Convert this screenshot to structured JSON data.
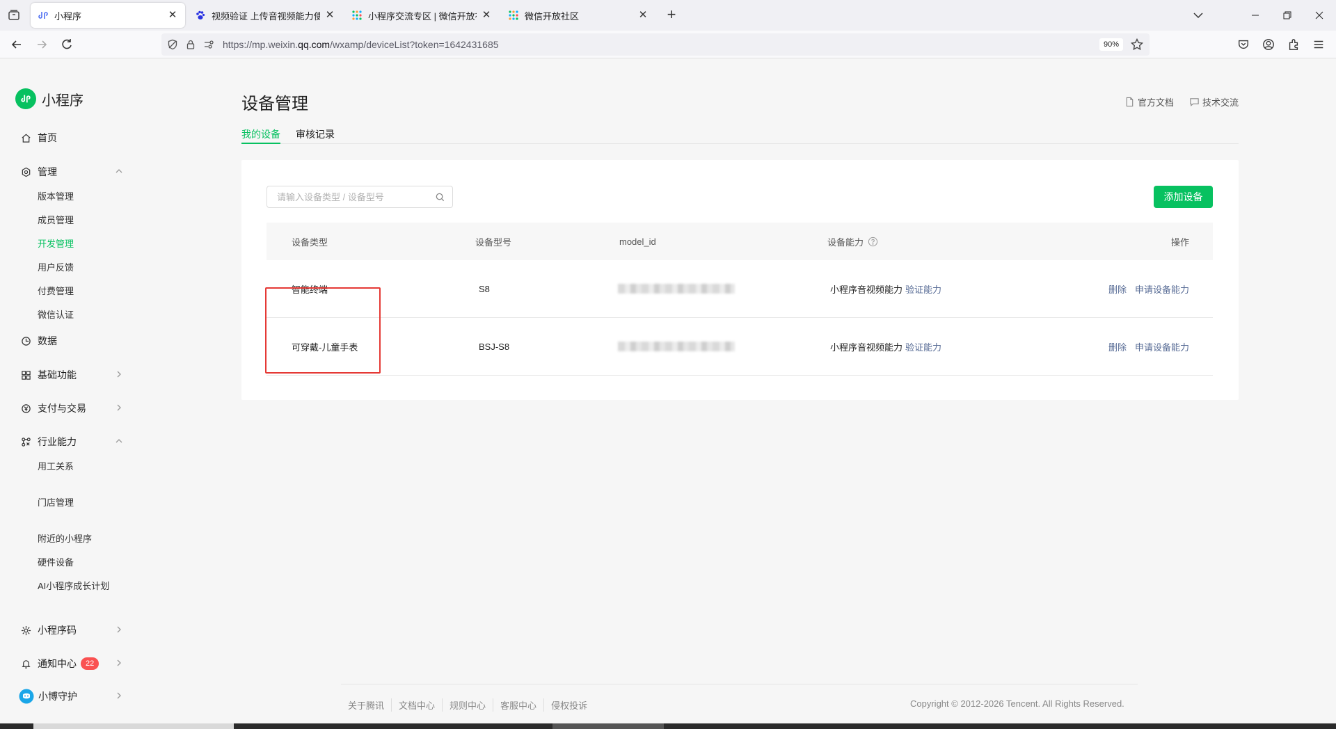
{
  "browser": {
    "tabs": [
      {
        "label": "小程序",
        "active": true,
        "favicon": "weixin-icon"
      },
      {
        "label": "视频验证 上传音视频能力使用说",
        "active": false,
        "favicon": "baidu-paw-icon"
      },
      {
        "label": "小程序交流专区 | 微信开放社区",
        "active": false,
        "favicon": "grid-dots-icon"
      },
      {
        "label": "微信开放社区",
        "active": false,
        "favicon": "grid-dots-icon"
      }
    ],
    "url_prefix": "https://mp.weixin.",
    "url_host": "qq.com",
    "url_suffix": "/wxamp/deviceList?token=1642431685",
    "zoom": "90%"
  },
  "sidebar": {
    "brand": "小程序",
    "home": "首页",
    "manage": "管理",
    "manage_items": [
      "版本管理",
      "成员管理",
      "开发管理",
      "用户反馈",
      "付费管理",
      "微信认证"
    ],
    "active_item": "开发管理",
    "data": "数据",
    "basic": "基础功能",
    "pay": "支付与交易",
    "industry": "行业能力",
    "industry_items": [
      "用工关系",
      "门店管理",
      "附近的小程序",
      "硬件设备",
      "AI小程序成长计划"
    ],
    "qrcode": "小程序码",
    "notify": "通知中心",
    "notify_count": "22",
    "account": "小博守护"
  },
  "main": {
    "title": "设备管理",
    "doc_link": "官方文档",
    "forum_link": "技术交流",
    "tabs": [
      "我的设备",
      "审核记录"
    ],
    "search_placeholder": "请输入设备类型 / 设备型号",
    "add_button": "添加设备",
    "columns": [
      "设备类型",
      "设备型号",
      "model_id",
      "设备能力",
      "操作"
    ],
    "rows": [
      {
        "type": "智能终端",
        "model": "S8",
        "capability": "小程序音视频能力",
        "verify": "验证能力",
        "delete": "删除",
        "apply": "申请设备能力"
      },
      {
        "type": "可穿戴-儿童手表",
        "model": "BSJ-S8",
        "capability": "小程序音视频能力",
        "verify": "验证能力",
        "delete": "删除",
        "apply": "申请设备能力"
      }
    ]
  },
  "footer": {
    "links": [
      "关于腾讯",
      "文档中心",
      "规则中心",
      "客服中心",
      "侵权投诉"
    ],
    "copyright": "Copyright © 2012-2026 Tencent. All Rights Reserved."
  },
  "colors": {
    "accent": "#07c160",
    "link": "#576b95",
    "highlight": "#e53935",
    "badge": "#fa5151"
  }
}
